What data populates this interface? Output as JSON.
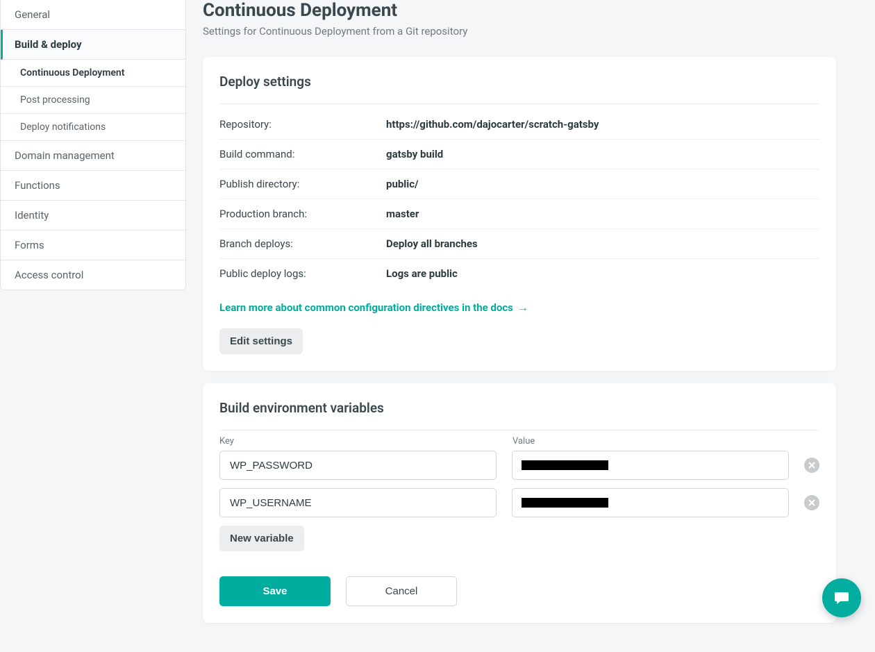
{
  "sidebar": {
    "items": [
      {
        "label": "General"
      },
      {
        "label": "Build & deploy"
      },
      {
        "label": "Domain management"
      },
      {
        "label": "Functions"
      },
      {
        "label": "Identity"
      },
      {
        "label": "Forms"
      },
      {
        "label": "Access control"
      }
    ],
    "subitems": [
      {
        "label": "Continuous Deployment"
      },
      {
        "label": "Post processing"
      },
      {
        "label": "Deploy notifications"
      }
    ]
  },
  "header": {
    "title": "Continuous Deployment",
    "subtitle": "Settings for Continuous Deployment from a Git repository"
  },
  "deploy_settings": {
    "title": "Deploy settings",
    "rows": [
      {
        "label": "Repository:",
        "value": "https://github.com/dajocarter/scratch-gatsby"
      },
      {
        "label": "Build command:",
        "value": "gatsby build"
      },
      {
        "label": "Publish directory:",
        "value": "public/"
      },
      {
        "label": "Production branch:",
        "value": "master"
      },
      {
        "label": "Branch deploys:",
        "value": "Deploy all branches"
      },
      {
        "label": "Public deploy logs:",
        "value": "Logs are public"
      }
    ],
    "learn_more": "Learn more about common configuration directives in the docs",
    "edit_button": "Edit settings"
  },
  "env_vars": {
    "title": "Build environment variables",
    "key_header": "Key",
    "value_header": "Value",
    "rows": [
      {
        "key": "WP_PASSWORD",
        "value_redacted": true
      },
      {
        "key": "WP_USERNAME",
        "value_redacted": true
      }
    ],
    "new_button": "New variable",
    "save_button": "Save",
    "cancel_button": "Cancel"
  }
}
